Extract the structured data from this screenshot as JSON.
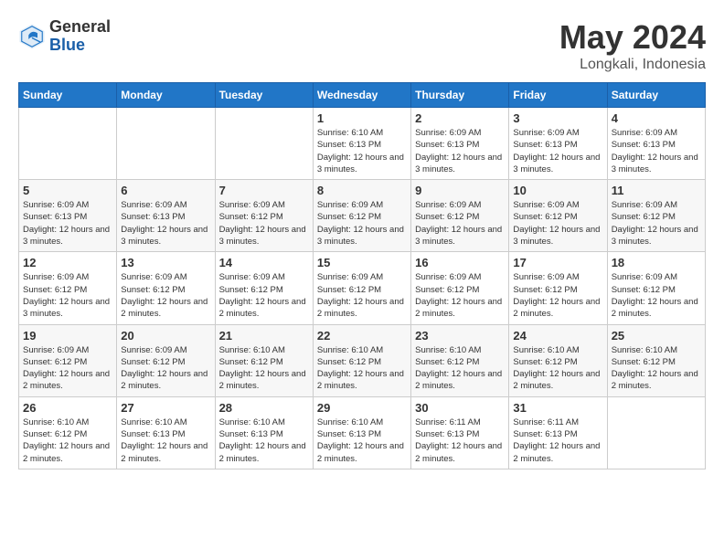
{
  "logo": {
    "general": "General",
    "blue": "Blue"
  },
  "title": "May 2024",
  "location": "Longkali, Indonesia",
  "weekdays": [
    "Sunday",
    "Monday",
    "Tuesday",
    "Wednesday",
    "Thursday",
    "Friday",
    "Saturday"
  ],
  "weeks": [
    [
      {
        "day": "",
        "info": ""
      },
      {
        "day": "",
        "info": ""
      },
      {
        "day": "",
        "info": ""
      },
      {
        "day": "1",
        "info": "Sunrise: 6:10 AM\nSunset: 6:13 PM\nDaylight: 12 hours\nand 3 minutes."
      },
      {
        "day": "2",
        "info": "Sunrise: 6:09 AM\nSunset: 6:13 PM\nDaylight: 12 hours\nand 3 minutes."
      },
      {
        "day": "3",
        "info": "Sunrise: 6:09 AM\nSunset: 6:13 PM\nDaylight: 12 hours\nand 3 minutes."
      },
      {
        "day": "4",
        "info": "Sunrise: 6:09 AM\nSunset: 6:13 PM\nDaylight: 12 hours\nand 3 minutes."
      }
    ],
    [
      {
        "day": "5",
        "info": "Sunrise: 6:09 AM\nSunset: 6:13 PM\nDaylight: 12 hours\nand 3 minutes."
      },
      {
        "day": "6",
        "info": "Sunrise: 6:09 AM\nSunset: 6:13 PM\nDaylight: 12 hours\nand 3 minutes."
      },
      {
        "day": "7",
        "info": "Sunrise: 6:09 AM\nSunset: 6:12 PM\nDaylight: 12 hours\nand 3 minutes."
      },
      {
        "day": "8",
        "info": "Sunrise: 6:09 AM\nSunset: 6:12 PM\nDaylight: 12 hours\nand 3 minutes."
      },
      {
        "day": "9",
        "info": "Sunrise: 6:09 AM\nSunset: 6:12 PM\nDaylight: 12 hours\nand 3 minutes."
      },
      {
        "day": "10",
        "info": "Sunrise: 6:09 AM\nSunset: 6:12 PM\nDaylight: 12 hours\nand 3 minutes."
      },
      {
        "day": "11",
        "info": "Sunrise: 6:09 AM\nSunset: 6:12 PM\nDaylight: 12 hours\nand 3 minutes."
      }
    ],
    [
      {
        "day": "12",
        "info": "Sunrise: 6:09 AM\nSunset: 6:12 PM\nDaylight: 12 hours\nand 3 minutes."
      },
      {
        "day": "13",
        "info": "Sunrise: 6:09 AM\nSunset: 6:12 PM\nDaylight: 12 hours\nand 2 minutes."
      },
      {
        "day": "14",
        "info": "Sunrise: 6:09 AM\nSunset: 6:12 PM\nDaylight: 12 hours\nand 2 minutes."
      },
      {
        "day": "15",
        "info": "Sunrise: 6:09 AM\nSunset: 6:12 PM\nDaylight: 12 hours\nand 2 minutes."
      },
      {
        "day": "16",
        "info": "Sunrise: 6:09 AM\nSunset: 6:12 PM\nDaylight: 12 hours\nand 2 minutes."
      },
      {
        "day": "17",
        "info": "Sunrise: 6:09 AM\nSunset: 6:12 PM\nDaylight: 12 hours\nand 2 minutes."
      },
      {
        "day": "18",
        "info": "Sunrise: 6:09 AM\nSunset: 6:12 PM\nDaylight: 12 hours\nand 2 minutes."
      }
    ],
    [
      {
        "day": "19",
        "info": "Sunrise: 6:09 AM\nSunset: 6:12 PM\nDaylight: 12 hours\nand 2 minutes."
      },
      {
        "day": "20",
        "info": "Sunrise: 6:09 AM\nSunset: 6:12 PM\nDaylight: 12 hours\nand 2 minutes."
      },
      {
        "day": "21",
        "info": "Sunrise: 6:10 AM\nSunset: 6:12 PM\nDaylight: 12 hours\nand 2 minutes."
      },
      {
        "day": "22",
        "info": "Sunrise: 6:10 AM\nSunset: 6:12 PM\nDaylight: 12 hours\nand 2 minutes."
      },
      {
        "day": "23",
        "info": "Sunrise: 6:10 AM\nSunset: 6:12 PM\nDaylight: 12 hours\nand 2 minutes."
      },
      {
        "day": "24",
        "info": "Sunrise: 6:10 AM\nSunset: 6:12 PM\nDaylight: 12 hours\nand 2 minutes."
      },
      {
        "day": "25",
        "info": "Sunrise: 6:10 AM\nSunset: 6:12 PM\nDaylight: 12 hours\nand 2 minutes."
      }
    ],
    [
      {
        "day": "26",
        "info": "Sunrise: 6:10 AM\nSunset: 6:12 PM\nDaylight: 12 hours\nand 2 minutes."
      },
      {
        "day": "27",
        "info": "Sunrise: 6:10 AM\nSunset: 6:13 PM\nDaylight: 12 hours\nand 2 minutes."
      },
      {
        "day": "28",
        "info": "Sunrise: 6:10 AM\nSunset: 6:13 PM\nDaylight: 12 hours\nand 2 minutes."
      },
      {
        "day": "29",
        "info": "Sunrise: 6:10 AM\nSunset: 6:13 PM\nDaylight: 12 hours\nand 2 minutes."
      },
      {
        "day": "30",
        "info": "Sunrise: 6:11 AM\nSunset: 6:13 PM\nDaylight: 12 hours\nand 2 minutes."
      },
      {
        "day": "31",
        "info": "Sunrise: 6:11 AM\nSunset: 6:13 PM\nDaylight: 12 hours\nand 2 minutes."
      },
      {
        "day": "",
        "info": ""
      }
    ]
  ]
}
